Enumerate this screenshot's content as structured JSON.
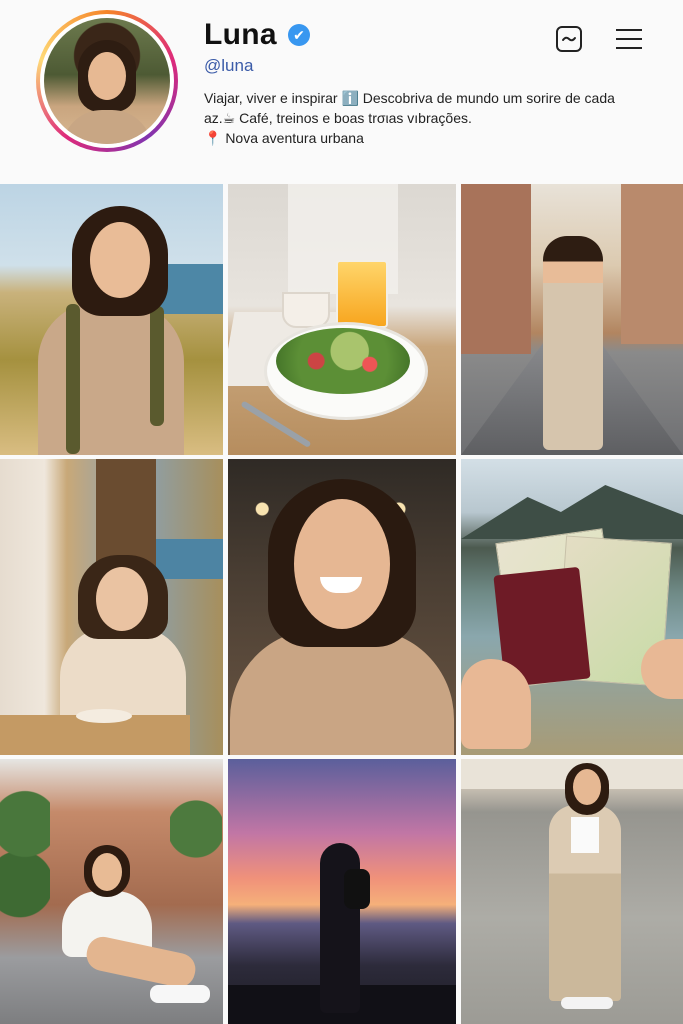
{
  "profile": {
    "name": "Luna",
    "verified_mark": "✔",
    "handle": "@luna",
    "bio_lines": [
      "Viajar, viver e inspirar ℹ️ Descobriva de mundo um sorire de cada",
      "az.☕ Café, treinos e boas trσιas vıbrações.",
      "📍 Nova aventura urbana"
    ]
  },
  "header_icons": {
    "message": "message-icon",
    "menu": "hamburger-menu-icon"
  },
  "colors": {
    "accent": "#3897f0",
    "handle": "#3b5ba8",
    "background": "#fafafa"
  },
  "grid": {
    "posts": [
      {
        "subject": "hiker-coast"
      },
      {
        "subject": "salad-bowl"
      },
      {
        "subject": "cobblestone-street"
      },
      {
        "subject": "coffee-window"
      },
      {
        "subject": "selfie"
      },
      {
        "subject": "passport-map"
      },
      {
        "subject": "sitting-street"
      },
      {
        "subject": "sunset-silhouette"
      },
      {
        "subject": "plaza-standing"
      }
    ]
  }
}
